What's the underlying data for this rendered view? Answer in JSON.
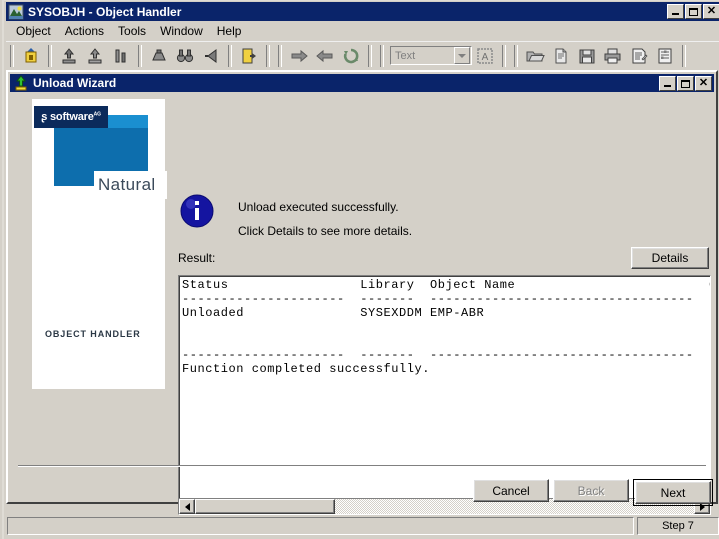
{
  "window": {
    "title": "SYSOBJH - Object Handler",
    "icon": "app-icon",
    "controls": [
      {
        "name": "minimize",
        "label": "_"
      },
      {
        "name": "maximize",
        "label": "□"
      },
      {
        "name": "close",
        "label": "✕"
      }
    ]
  },
  "menubar": {
    "items": [
      {
        "label": "Object"
      },
      {
        "label": "Actions"
      },
      {
        "label": "Tools"
      },
      {
        "label": "Window"
      },
      {
        "label": "Help"
      }
    ]
  },
  "toolbar": {
    "combo": {
      "value": "Text",
      "placeholder": "Text"
    },
    "groups": [
      {
        "icons": [
          {
            "name": "object-handler-icon"
          }
        ]
      },
      {
        "icons": [
          {
            "name": "load-icon"
          },
          {
            "name": "unload-icon"
          },
          {
            "name": "compare-icon"
          }
        ]
      },
      {
        "icons": [
          {
            "name": "find-icon"
          },
          {
            "name": "binoculars-icon"
          },
          {
            "name": "select-icon"
          }
        ]
      },
      {
        "icons": [
          {
            "name": "exit-icon"
          }
        ]
      },
      {
        "icons": [
          {
            "name": "forward-arrow-icon"
          },
          {
            "name": "back-arrow-icon"
          },
          {
            "name": "refresh-icon"
          }
        ]
      },
      {
        "icons": [
          {
            "name": "view-text-icon"
          }
        ]
      },
      {
        "icons": [
          {
            "name": "open-folder-icon"
          },
          {
            "name": "new-document-icon"
          },
          {
            "name": "save-icon"
          },
          {
            "name": "print-icon"
          },
          {
            "name": "edit-list-icon"
          },
          {
            "name": "properties-icon"
          }
        ]
      }
    ]
  },
  "wizard": {
    "title": "Unload Wizard",
    "icon": "unload-wizard-icon",
    "controls": [
      {
        "name": "minimize",
        "label": "_"
      },
      {
        "name": "maximize",
        "label": "□"
      },
      {
        "name": "close",
        "label": "✕"
      }
    ],
    "sidebar": {
      "brand": "software",
      "brand_sup": "AG",
      "product": "Natural",
      "module": "OBJECT HANDLER"
    },
    "info_icon": "information-icon",
    "message_line1": "Unload executed successfully.",
    "message_line2": "Click Details to see more details.",
    "result_label": "Result:",
    "details_button": "Details",
    "result_text": "Status                 Library  Object Name                         Object Type  S\n---------------------  -------  ----------------------------------  -----------  -\nUnloaded               SYSEXDDM EMP-ABR                             DDM          S\n\n\n---------------------  -------  ----------------------------------  -----------  -\nFunction completed successfully.",
    "buttons": {
      "cancel": "Cancel",
      "back": "Back",
      "next": "Next"
    }
  },
  "statusbar": {
    "message": "",
    "step": "Step 7"
  },
  "colors": {
    "titlebar": "#0a246a",
    "face": "#d4d0c8",
    "info_blue": "#1414a0",
    "brand_dark": "#0b2a5b",
    "brand_mid": "#0d6ead",
    "brand_light": "#1a8fd0"
  }
}
